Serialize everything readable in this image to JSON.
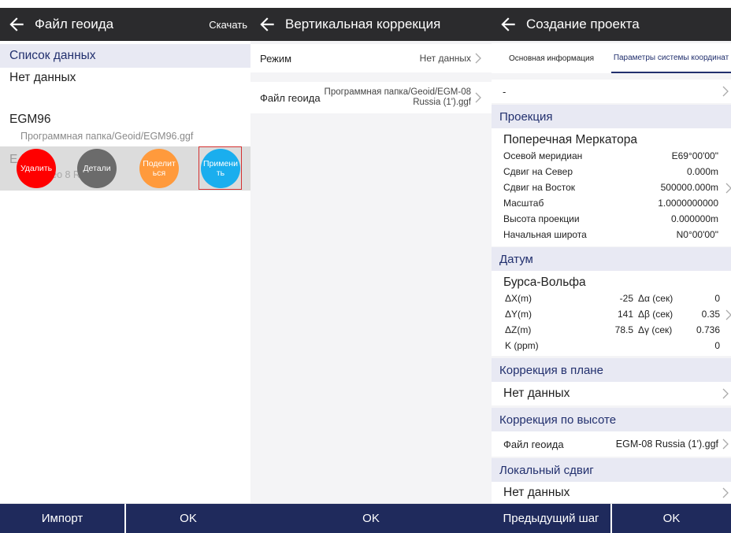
{
  "panel1": {
    "title": "Файл геоида",
    "download": "Скачать",
    "list_header": "Список данных",
    "no_data": "Нет данных",
    "item1_name": "EGM96",
    "item1_path": "Программная папка/Geoid/EGM96.ggf",
    "item2_name": "E Rus",
    "item2_path": "мна /Geo 8 Ru",
    "actions": {
      "delete": "Удалить",
      "details": "Детали",
      "share": "Поделит ься",
      "apply": "Примени ть"
    },
    "btn_import": "Импорт",
    "btn_ok": "OK"
  },
  "panel2": {
    "title": "Вертикальная коррекция",
    "mode_label": "Режим",
    "mode_value": "Нет данных",
    "geoid_label": "Файл геоида",
    "geoid_value": "Программная папка/Geoid/EGM-08 Russia (1').ggf",
    "btn_ok": "OK"
  },
  "panel3": {
    "title": "Создание проекта",
    "tab_basic": "Основная информация",
    "tab_params": "Параметры системы координат",
    "dash": "-",
    "projection_header": "Проекция",
    "projection_name": "Поперечная Меркатора",
    "proj": [
      {
        "k": "Осевой меридиан",
        "v": "E69°00'00\""
      },
      {
        "k": "Сдвиг на Север",
        "v": "0.000m"
      },
      {
        "k": "Сдвиг на Восток",
        "v": "500000.000m"
      },
      {
        "k": "Масштаб",
        "v": "1.0000000000"
      },
      {
        "k": "Высота проекции",
        "v": "0.000000m"
      },
      {
        "k": "Начальная широта",
        "v": "N0°00'00\""
      }
    ],
    "datum_header": "Датум",
    "datum_name": "Бурса-Вольфа",
    "datum": [
      {
        "a": "ΔX(m)",
        "b": "-25",
        "c": "Δα (сек)",
        "d": "0"
      },
      {
        "a": "ΔY(m)",
        "b": "141",
        "c": "Δβ (сек)",
        "d": "0.35"
      },
      {
        "a": "ΔZ(m)",
        "b": "78.5",
        "c": "Δγ (сек)",
        "d": "0.736"
      },
      {
        "a": "K (ppm)",
        "b": "",
        "c": "",
        "d": "0"
      }
    ],
    "plane_header": "Коррекция в плане",
    "plane_value": "Нет данных",
    "height_header": "Коррекция по высоте",
    "height_label": "Файл геоида",
    "height_value": "EGM-08 Russia (1').ggf",
    "shift_header": "Локальный сдвиг",
    "shift_value": "Нет данных",
    "btn_prev": "Предыдущий шаг",
    "btn_ok": "OK"
  }
}
